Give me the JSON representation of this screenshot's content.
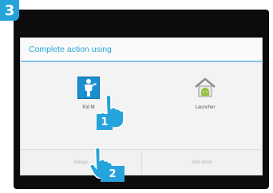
{
  "step_number": "3",
  "dialog": {
    "title": "Complete action using",
    "apps": [
      {
        "label": "Kid M"
      },
      {
        "label": "Launcher"
      }
    ],
    "buttons": {
      "always": "Always",
      "just_once": "Just once"
    }
  },
  "markers": [
    "1",
    "2"
  ],
  "colors": {
    "accent": "#27a3dc",
    "screen_bg": "#0c0c0c",
    "dialog_bg": "#f3f3f3",
    "title_text": "#2ba6d9"
  },
  "icons": [
    "kid-mode-app-icon",
    "launcher-app-icon",
    "pointing-hand-icon"
  ]
}
